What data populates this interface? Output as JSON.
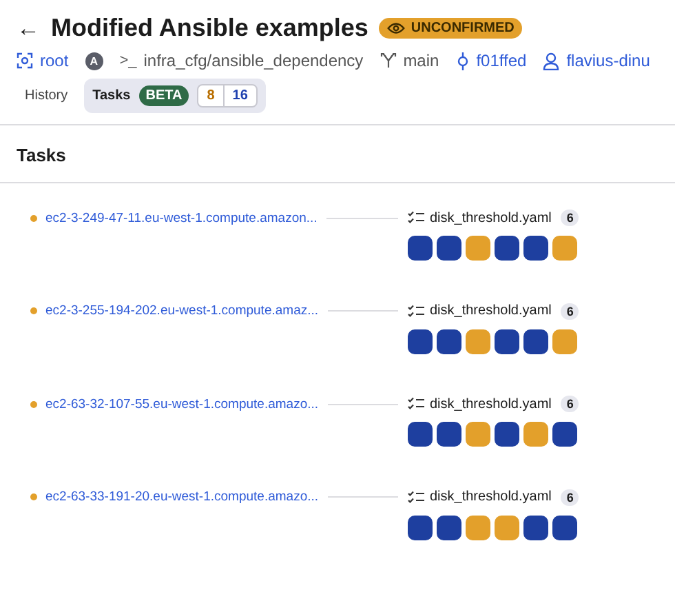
{
  "header": {
    "back": "←",
    "title": "Modified Ansible examples",
    "status_badge": "UNCONFIRMED"
  },
  "meta": [
    {
      "kind": "stack",
      "text": "root"
    },
    {
      "kind": "avatar",
      "initial": "A"
    },
    {
      "kind": "project",
      "prompt": ">_",
      "text": "infra_cfg/ansible_dependency"
    },
    {
      "kind": "branch",
      "text": "main"
    },
    {
      "kind": "commit",
      "text": "f01ffed"
    },
    {
      "kind": "user",
      "text": "flavius-dinu"
    }
  ],
  "tabs": [
    {
      "label": "History",
      "selected": false
    },
    {
      "label": "Tasks",
      "selected": true,
      "badge": "BETA",
      "counts": [
        {
          "text": "8",
          "color": "#b86e00"
        },
        {
          "text": "16",
          "color": "#1e40af"
        }
      ]
    }
  ],
  "section_title": "Tasks",
  "rows": [
    {
      "host": "ec2-3-249-47-11.eu-west-1.compute.amazon...",
      "color": "#e3a02b",
      "file": "disk_threshold.yaml",
      "count": "6",
      "statuses": [
        {
          "color": "#1e3f9f"
        },
        {
          "color": "#1e3f9f"
        },
        {
          "color": "#e3a02b"
        },
        {
          "color": "#1e3f9f"
        },
        {
          "color": "#1e3f9f"
        },
        {
          "color": "#e3a02b"
        }
      ]
    },
    {
      "host": "ec2-3-255-194-202.eu-west-1.compute.amaz...",
      "color": "#e3a02b",
      "file": "disk_threshold.yaml",
      "count": "6",
      "statuses": [
        {
          "color": "#1e3f9f"
        },
        {
          "color": "#1e3f9f"
        },
        {
          "color": "#e3a02b"
        },
        {
          "color": "#1e3f9f"
        },
        {
          "color": "#1e3f9f"
        },
        {
          "color": "#e3a02b"
        }
      ]
    },
    {
      "host": "ec2-63-32-107-55.eu-west-1.compute.amazo...",
      "color": "#e3a02b",
      "file": "disk_threshold.yaml",
      "count": "6",
      "statuses": [
        {
          "color": "#1e3f9f"
        },
        {
          "color": "#1e3f9f"
        },
        {
          "color": "#e3a02b"
        },
        {
          "color": "#1e3f9f"
        },
        {
          "color": "#e3a02b"
        },
        {
          "color": "#1e3f9f"
        }
      ]
    },
    {
      "host": "ec2-63-33-191-20.eu-west-1.compute.amazo...",
      "color": "#e3a02b",
      "file": "disk_threshold.yaml",
      "count": "6",
      "statuses": [
        {
          "color": "#1e3f9f"
        },
        {
          "color": "#1e3f9f"
        },
        {
          "color": "#e3a02b"
        },
        {
          "color": "#e3a02b"
        },
        {
          "color": "#1e3f9f"
        },
        {
          "color": "#1e3f9f"
        }
      ]
    }
  ]
}
